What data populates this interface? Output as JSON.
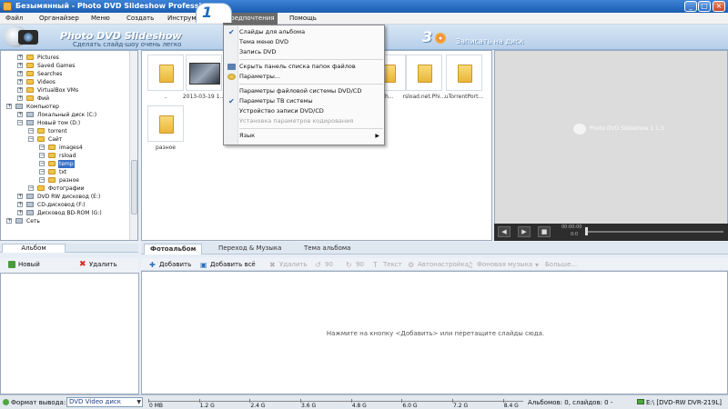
{
  "window": {
    "title": "Безымянный - Photo DVD Slideshow Professional",
    "min": "_",
    "max": "□",
    "close": "×"
  },
  "menubar": {
    "items": [
      "Файл",
      "Органайзер",
      "Меню",
      "Создать",
      "Инструменты",
      "Предпочтения",
      "Помощь"
    ],
    "active_index": 5
  },
  "banner": {
    "app_name": "Photo DVD Slideshow",
    "tagline": "Сделать слайд-шоу очень легко",
    "step1": "1",
    "step3": "3",
    "step3_label": "Записать на диск"
  },
  "tree": {
    "items": [
      {
        "label": "Pictures",
        "indent": 1,
        "type": "folder"
      },
      {
        "label": "Saved Games",
        "indent": 1,
        "type": "folder"
      },
      {
        "label": "Searches",
        "indent": 1,
        "type": "folder"
      },
      {
        "label": "Videos",
        "indent": 1,
        "type": "folder"
      },
      {
        "label": "VirtualBox VMs",
        "indent": 1,
        "type": "folder"
      },
      {
        "label": "Фий",
        "indent": 1,
        "type": "folder"
      },
      {
        "label": "Компьютер",
        "indent": 0,
        "type": "computer"
      },
      {
        "label": "Локальный диск (C:)",
        "indent": 1,
        "type": "drive"
      },
      {
        "label": "Новый том (D:)",
        "indent": 1,
        "type": "drive"
      },
      {
        "label": "torrent",
        "indent": 2,
        "type": "folder"
      },
      {
        "label": "Сайт",
        "indent": 2,
        "type": "folder"
      },
      {
        "label": "images4",
        "indent": 3,
        "type": "folder"
      },
      {
        "label": "rsload",
        "indent": 3,
        "type": "folder"
      },
      {
        "label": "temp",
        "indent": 3,
        "type": "folder",
        "selected": true
      },
      {
        "label": "txt",
        "indent": 3,
        "type": "folder"
      },
      {
        "label": "разное",
        "indent": 3,
        "type": "folder"
      },
      {
        "label": "Фотографии",
        "indent": 2,
        "type": "folder"
      },
      {
        "label": "DVD RW дисковод (E:)",
        "indent": 1,
        "type": "drive"
      },
      {
        "label": "CD-дисковод (F:)",
        "indent": 1,
        "type": "drive"
      },
      {
        "label": "Дисковод BD-ROM (G:)",
        "indent": 1,
        "type": "drive"
      },
      {
        "label": "Сеть",
        "indent": 0,
        "type": "network"
      }
    ]
  },
  "thumbnails": [
    {
      "caption": "..",
      "kind": "folder"
    },
    {
      "caption": "2013-03-19 1...",
      "kind": "photo"
    },
    {
      "caption": "Ph...",
      "kind": "folder"
    },
    {
      "caption": "rsload.net.Phi...",
      "kind": "folder"
    },
    {
      "caption": "uTorrentPort...",
      "kind": "folder"
    },
    {
      "caption": "разное",
      "kind": "folder"
    }
  ],
  "preview": {
    "watermark": "Photo DVD Slideshow 1.1.3",
    "time": "00:00:00",
    "time2": "0:0",
    "play": "▶",
    "prev": "◀",
    "stop": "■"
  },
  "album": {
    "tab": "Альбом",
    "new_label": "Новый",
    "delete_label": "Удалить"
  },
  "slides": {
    "tabs": [
      "Фотоальбом",
      "Переход & Музыка",
      "Тема альбома"
    ],
    "toolbar": [
      {
        "label": "Добавить",
        "enabled": true
      },
      {
        "label": "Добавить всё",
        "enabled": true
      },
      {
        "label": "Удалить",
        "enabled": false
      },
      {
        "label": "90",
        "enabled": false
      },
      {
        "label": "90",
        "enabled": false
      },
      {
        "label": "Текст",
        "enabled": false
      },
      {
        "label": "Автонастройка",
        "enabled": false
      },
      {
        "label": "Фоновая музыка",
        "enabled": false
      },
      {
        "label": "Больше...",
        "enabled": false
      }
    ],
    "hint": "Нажмите на кнопку <Добавить> или перетащите слайды сюда."
  },
  "status": {
    "format_label": "Формат вывода:",
    "format_value": "DVD Video диск",
    "capacity_ticks": [
      "0 MB",
      "1.2 G",
      "2.4 G",
      "3.6 G",
      "4.8 G",
      "6.0 G",
      "7.2 G",
      "8.4 G"
    ],
    "albums_info": "Альбомов: 0, слайдов: 0 -",
    "drive": "E:\\ [DVD-RW  DVR-219L]"
  },
  "dropdown": {
    "items": [
      {
        "label": "Слайды для альбома",
        "checked": true,
        "enabled": true
      },
      {
        "label": "Тема меню DVD",
        "checked": false,
        "enabled": true
      },
      {
        "label": "Запись DVD",
        "checked": false,
        "enabled": true
      },
      {
        "sep": true
      },
      {
        "label": "Скрыть панель списка папок файлов",
        "checked": false,
        "enabled": true,
        "icon": "panel-icon"
      },
      {
        "label": "Параметры...",
        "checked": false,
        "enabled": true,
        "icon": "settings-icon"
      },
      {
        "sep": true
      },
      {
        "label": "Параметры файловой системы DVD/CD",
        "checked": false,
        "enabled": true
      },
      {
        "label": "Параметры ТВ системы",
        "checked": true,
        "enabled": true
      },
      {
        "label": "Устройство записи DVD/CD",
        "checked": false,
        "enabled": true
      },
      {
        "label": "Установка параметров кодирования",
        "checked": false,
        "enabled": false
      },
      {
        "sep": true
      },
      {
        "label": "Язык",
        "checked": false,
        "enabled": true,
        "submenu": true
      }
    ]
  },
  "colors": {
    "accent": "#3570c8",
    "titlebar": "#1b5cb0",
    "menu_active": "#6a6a6a"
  }
}
